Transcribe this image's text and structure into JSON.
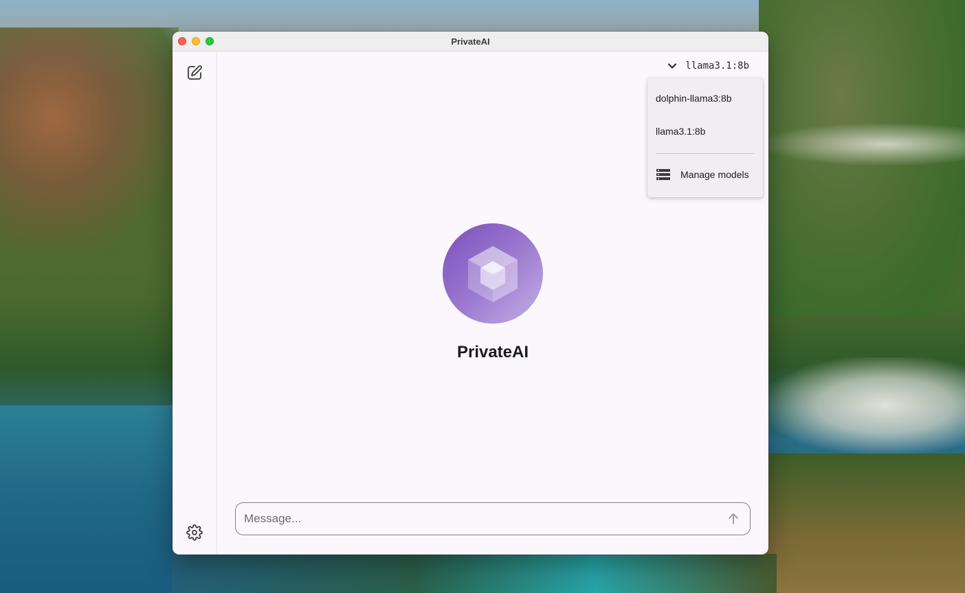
{
  "window": {
    "title": "PrivateAI"
  },
  "model_selector": {
    "selected": "llama3.1:8b",
    "options": [
      "dolphin-llama3:8b",
      "llama3.1:8b"
    ],
    "manage_label": "Manage models"
  },
  "hero": {
    "app_name": "PrivateAI"
  },
  "composer": {
    "placeholder": "Message..."
  },
  "icons": {
    "compose": "compose-icon",
    "settings": "gear-icon",
    "chevron": "chevron-down-icon",
    "manage": "server-icon",
    "send": "arrow-up-icon",
    "logo": "cube-icon"
  },
  "colors": {
    "accent": "#7a4fbc",
    "window_bg": "#fcf6fd"
  }
}
